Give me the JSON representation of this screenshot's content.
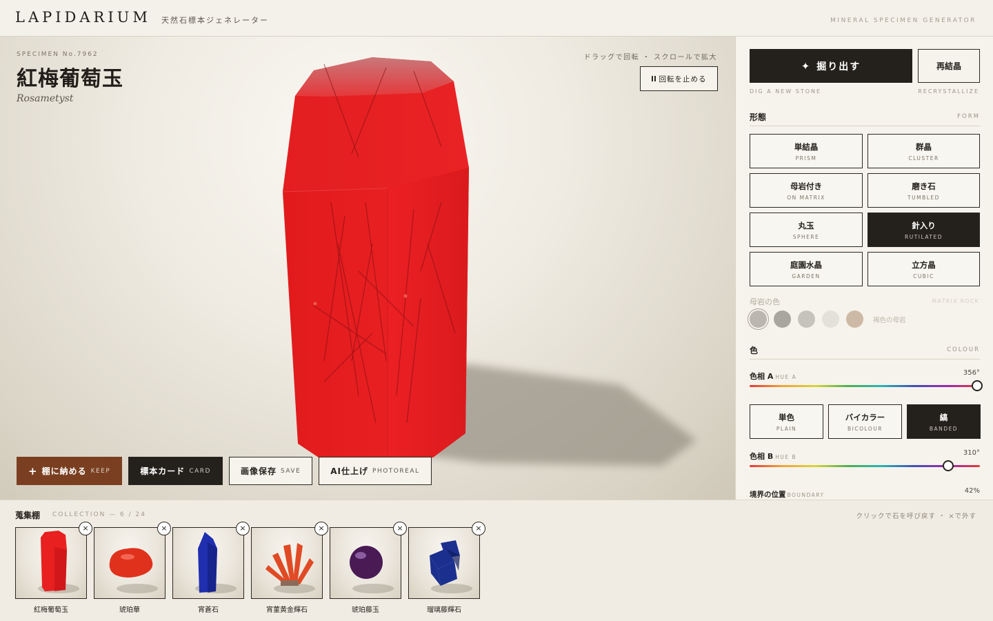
{
  "header": {
    "brand": "LAPIDARIUM",
    "brand_sub": "天然石標本ジェネレーター",
    "tagline": "MINERAL SPECIMEN GENERATOR"
  },
  "stage": {
    "specimen_no": "SPECIMEN No.7962",
    "name": "紅梅葡萄玉",
    "latin": "Rosametyst",
    "hint": "ドラッグで回転 ・ スクロールで拡大",
    "stop_rotation": "回転を止める",
    "crystal_color": "#e8201f",
    "actions": {
      "keep": {
        "jp": "棚に納める",
        "en": "KEEP"
      },
      "card": {
        "jp": "標本カード",
        "en": "CARD"
      },
      "save": {
        "jp": "画像保存",
        "en": "SAVE"
      },
      "photoreal": {
        "jp": "AI仕上げ",
        "en": "PHOTOREAL"
      }
    }
  },
  "panel": {
    "dig": "掘り出す",
    "dig_sub": "DIG A NEW STONE",
    "recrystallize": "再結晶",
    "recrystallize_sub": "RECRYSTALLIZE",
    "form": {
      "title": "形態",
      "title_en": "FORM",
      "options": [
        {
          "jp": "単結晶",
          "en": "PRISM",
          "active": false
        },
        {
          "jp": "群晶",
          "en": "CLUSTER",
          "active": false
        },
        {
          "jp": "母岩付き",
          "en": "ON MATRIX",
          "active": false
        },
        {
          "jp": "磨き石",
          "en": "TUMBLED",
          "active": false
        },
        {
          "jp": "丸玉",
          "en": "SPHERE",
          "active": false
        },
        {
          "jp": "針入り",
          "en": "RUTILATED",
          "active": true
        },
        {
          "jp": "庭園水晶",
          "en": "GARDEN",
          "active": false
        },
        {
          "jp": "立方晶",
          "en": "CUBIC",
          "active": false
        }
      ]
    },
    "matrix": {
      "label": "母岩の色",
      "label_en": "MATRIX ROCK",
      "swatches": [
        "#a8a49c",
        "#8f8c86",
        "#b5b3ae",
        "#dddad4",
        "#bfa58d"
      ],
      "selected": 0,
      "note": "褐色の母岩"
    },
    "colour": {
      "title": "色",
      "title_en": "COLOUR",
      "hue_a": {
        "label": "色相 A",
        "en": "HUE A",
        "value": 356,
        "display": "356°"
      },
      "modes": [
        {
          "jp": "単色",
          "en": "PLAIN",
          "active": false
        },
        {
          "jp": "バイカラー",
          "en": "BICOLOUR",
          "active": false
        },
        {
          "jp": "縞",
          "en": "BANDED",
          "active": true
        }
      ],
      "hue_b": {
        "label": "色相 B",
        "en": "HUE B",
        "value": 310,
        "display": "310°"
      },
      "boundary": {
        "label": "境界の位置",
        "en": "BOUNDARY",
        "value": 42,
        "display": "42%"
      }
    }
  },
  "collection": {
    "title": "蒐集棚",
    "count": "COLLECTION — 6 / 24",
    "hint": "クリックで石を呼び戻す ・ ×で外す",
    "remove_glyph": "×",
    "items": [
      {
        "name": "紅梅葡萄玉",
        "shape": "prism",
        "color": "#e8201f"
      },
      {
        "name": "琥珀華",
        "shape": "tumbled",
        "color": "#e0311d"
      },
      {
        "name": "宵蒼石",
        "shape": "point",
        "color": "#1f2fb0"
      },
      {
        "name": "宵菫黄金輝石",
        "shape": "cluster",
        "color": "#e04a24"
      },
      {
        "name": "琥珀藤玉",
        "shape": "sphere",
        "color": "#4a1a55"
      },
      {
        "name": "瑠璃藤輝石",
        "shape": "cubic",
        "color": "#1b2f8f"
      }
    ]
  }
}
